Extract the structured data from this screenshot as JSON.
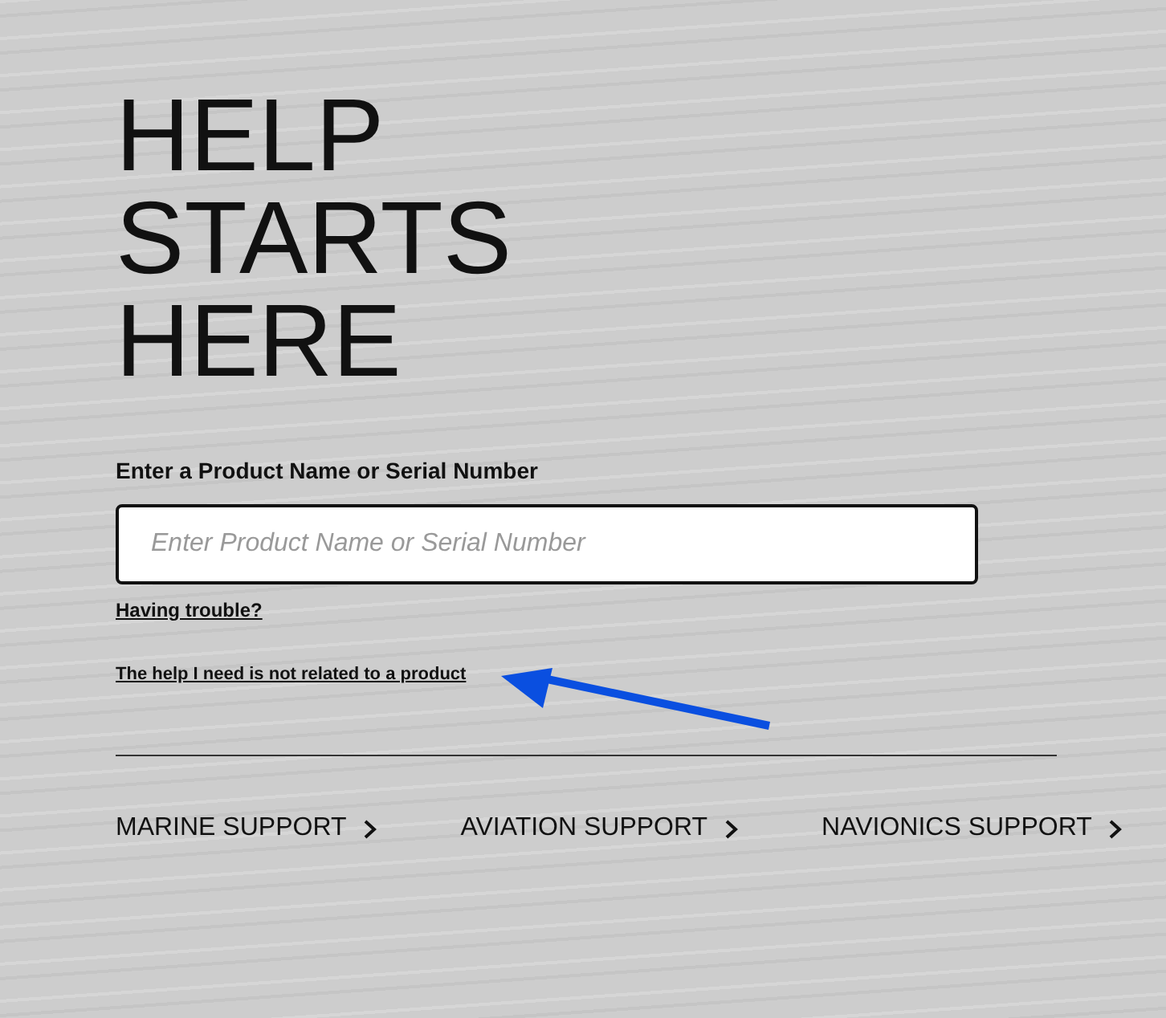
{
  "heading": [
    "HELP",
    "STARTS",
    "HERE"
  ],
  "search": {
    "label": "Enter a Product Name or Serial Number",
    "placeholder": "Enter Product Name or Serial Number"
  },
  "links": [
    "Having trouble?",
    "The help I need is not related to a product"
  ],
  "support_links": [
    "MARINE SUPPORT",
    "AVIATION SUPPORT",
    "NAVIONICS SUPPORT"
  ]
}
